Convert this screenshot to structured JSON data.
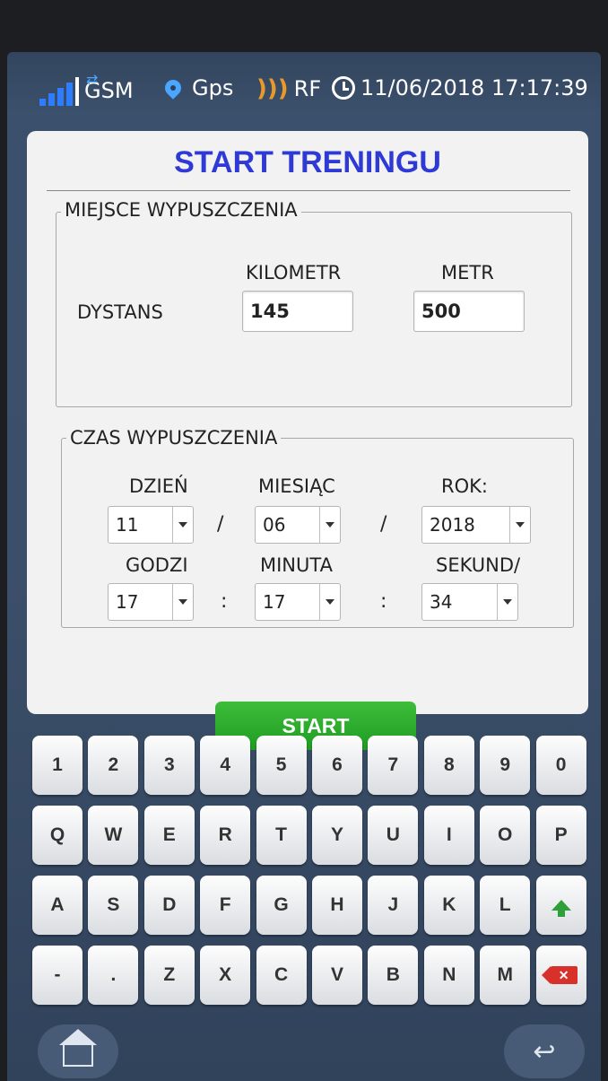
{
  "status_bar": {
    "network": "GSM",
    "gps": "Gps",
    "rf": "RF",
    "datetime": "11/06/2018 17:17:39"
  },
  "dialog": {
    "title": "START TRENINGU",
    "release_place": {
      "legend": "MIEJSCE WYPUSZCZENIA",
      "distance_label": "DYSTANS",
      "km_label": "KILOMETR",
      "m_label": "METR",
      "km_value": "145",
      "m_value": "500"
    },
    "release_time": {
      "legend": "CZAS WYPUSZCZENIA",
      "day_label": "DZIEŃ",
      "month_label": "MIESIĄC",
      "year_label": "ROK:",
      "hour_label": "GODZI",
      "minute_label": "MINUTA",
      "second_label": "SEKUND/",
      "day_value": "11",
      "month_value": "06",
      "year_value": "2018",
      "hour_value": "17",
      "minute_value": "17",
      "second_value": "34",
      "date_sep": "/",
      "time_sep": ":"
    },
    "start_button": "START"
  },
  "keyboard": {
    "rows": [
      [
        "1",
        "2",
        "3",
        "4",
        "5",
        "6",
        "7",
        "8",
        "9",
        "0"
      ],
      [
        "Q",
        "W",
        "E",
        "R",
        "T",
        "Y",
        "U",
        "I",
        "O",
        "P"
      ],
      [
        "A",
        "S",
        "D",
        "F",
        "G",
        "H",
        "J",
        "K",
        "L",
        "shift"
      ],
      [
        "-",
        ".",
        "Z",
        "X",
        "C",
        "V",
        "B",
        "N",
        "M",
        "backspace"
      ]
    ],
    "backspace_glyph": "✕"
  },
  "nav": {
    "back_glyph": "↩"
  },
  "colors": {
    "title": "#2f39d6",
    "start_button": "#2aa52c",
    "backspace": "#d8312b",
    "shift": "#2ea03a"
  }
}
